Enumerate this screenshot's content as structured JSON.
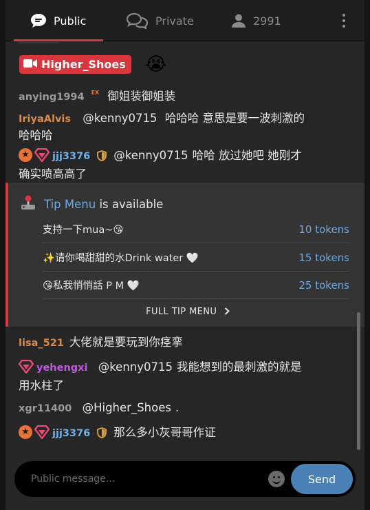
{
  "tabs": {
    "public_label": "Public",
    "private_label": "Private",
    "users_count": "2991"
  },
  "broadcaster": {
    "name": "Higher_Shoes",
    "emoji": "😭"
  },
  "messages": [
    {
      "user": "anying1994",
      "ex": "EX",
      "text": "御姐装御姐装"
    },
    {
      "user": "IriyaAlvis",
      "mention": "@kenny0715",
      "text": "哈哈哈 意思是要一波刺激的",
      "text2": "哈哈哈"
    },
    {
      "user": "jjj3376",
      "mention": "@kenny0715",
      "text": "哈哈 放过她吧 她刚才",
      "text2": "确实喷高高了"
    },
    {
      "user": "lisa_521",
      "text": "大佬就是要玩到你痉挛"
    },
    {
      "user": "yehengxi",
      "mention": "@kenny0715",
      "text": "我能想到的最刺激的就是",
      "text2": "用水柱了"
    },
    {
      "user": "xgr11400",
      "mention": "@Higher_Shoes",
      "text": "."
    },
    {
      "user": "jjj3376",
      "text": "那么多小灰哥哥作证"
    }
  ],
  "tip_menu": {
    "link": "Tip Menu",
    "suffix": "is available",
    "items": [
      {
        "label": "支持一下mua~😘",
        "price": "10 tokens"
      },
      {
        "label": "✨请你喝甜甜的水Drink water 🤍",
        "price": "15 tokens"
      },
      {
        "label": "😘私我悄悄話 P M 🤍",
        "price": "25 tokens"
      }
    ],
    "full_label": "FULL TIP MENU"
  },
  "input": {
    "placeholder": "Public message...",
    "send_label": "Send"
  },
  "colors": {
    "accent": "#d9363e",
    "link": "#6fa8e0",
    "send": "#4a82b8",
    "orange_user": "#d98a49",
    "purple_user": "#c455e6"
  }
}
